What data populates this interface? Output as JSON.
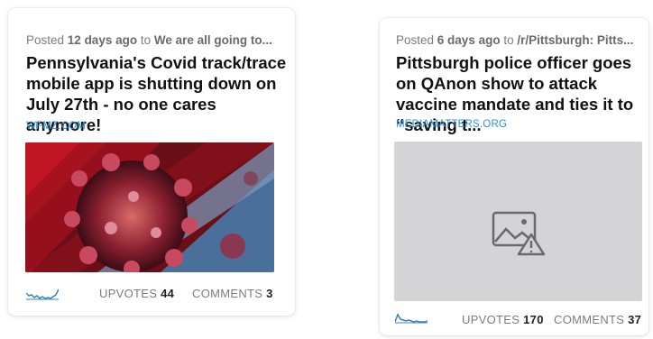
{
  "cards": [
    {
      "meta_prefix": "Posted",
      "age": "12 days ago",
      "meta_to": "to",
      "subreddit": "We are all going to...",
      "title": "Pennsylvania's Covid track/trace mobile app is shutting down on July 27th - no one cares anymore!",
      "domain": "WFMZ.COM",
      "image": "virus-image",
      "upvotes_label": "UPVOTES",
      "upvotes": "44",
      "comments_label": "COMMENTS",
      "comments": "3"
    },
    {
      "meta_prefix": "Posted",
      "age": "6 days ago",
      "meta_to": "to",
      "subreddit": "/r/Pittsburgh: Pitts...",
      "title": "Pittsburgh police officer goes on QAnon show to attack vaccine mandate and ties it to “saving t...",
      "domain": "MEDIAMATTERS.ORG",
      "image": "broken-image-icon",
      "upvotes_label": "UPVOTES",
      "upvotes": "170",
      "comments_label": "COMMENTS",
      "comments": "37"
    }
  ],
  "colors": {
    "link": "#2a8fd6",
    "sparkline": "#3b7fc4",
    "placeholder": "#d4d4d6"
  }
}
